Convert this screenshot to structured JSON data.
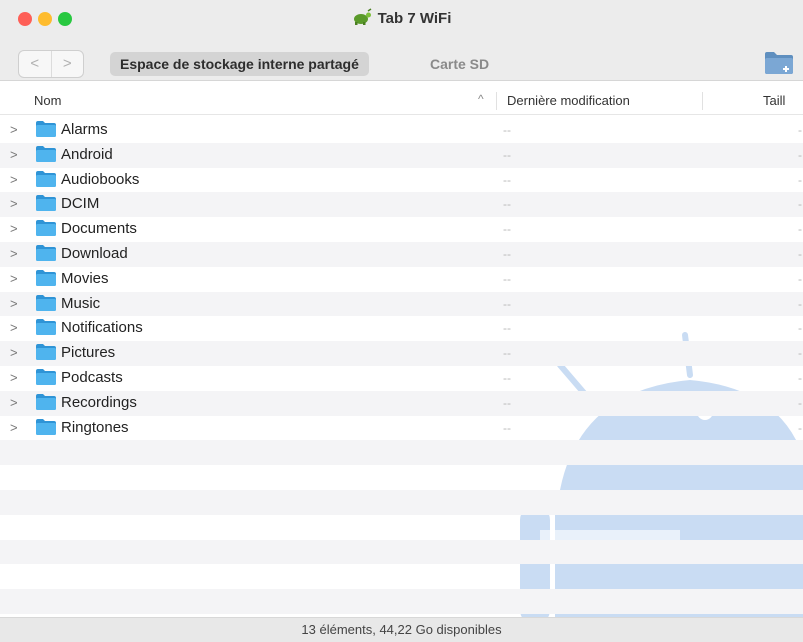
{
  "window": {
    "title": "Tab 7 WiFi"
  },
  "toolbar": {
    "back_glyph": "<",
    "forward_glyph": ">",
    "tabs": [
      {
        "label": "Espace de stockage interne partagé",
        "active": true
      },
      {
        "label": "Carte SD",
        "active": false
      }
    ],
    "new_folder_icon": "new-folder-icon"
  },
  "columns": {
    "name": "Nom",
    "sort_indicator": "^",
    "modified": "Dernière modification",
    "size": "Taill"
  },
  "rows": [
    {
      "name": "Alarms",
      "modified": "--",
      "size": "-"
    },
    {
      "name": "Android",
      "modified": "--",
      "size": "-"
    },
    {
      "name": "Audiobooks",
      "modified": "--",
      "size": "-"
    },
    {
      "name": "DCIM",
      "modified": "--",
      "size": "-"
    },
    {
      "name": "Documents",
      "modified": "--",
      "size": "-"
    },
    {
      "name": "Download",
      "modified": "--",
      "size": "-"
    },
    {
      "name": "Movies",
      "modified": "--",
      "size": "-"
    },
    {
      "name": "Music",
      "modified": "--",
      "size": "-"
    },
    {
      "name": "Notifications",
      "modified": "--",
      "size": "-"
    },
    {
      "name": "Pictures",
      "modified": "--",
      "size": "-"
    },
    {
      "name": "Podcasts",
      "modified": "--",
      "size": "-"
    },
    {
      "name": "Recordings",
      "modified": "--",
      "size": "-"
    },
    {
      "name": "Ringtones",
      "modified": "--",
      "size": "-"
    }
  ],
  "status": {
    "text": "13 éléments, 44,22 Go disponibles"
  },
  "colors": {
    "folder": "#39a7e8",
    "watermark": "#c9dcf3"
  }
}
